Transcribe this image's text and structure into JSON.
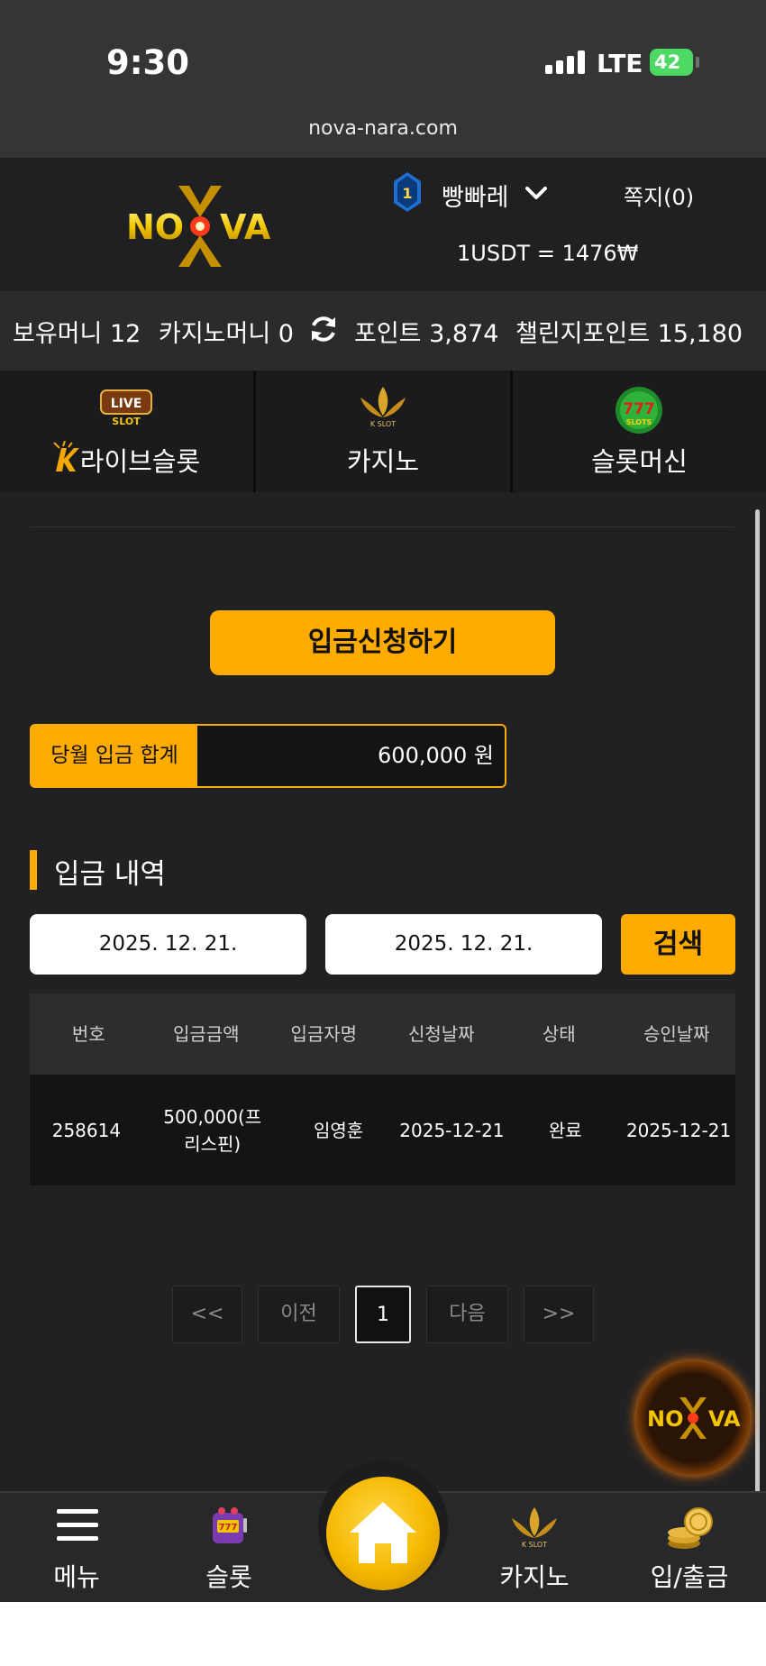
{
  "status_bar": {
    "time": "9:30",
    "network": "LTE",
    "battery": "42",
    "url": "nova-nara.com"
  },
  "header": {
    "logo_text": "NOVA",
    "rank": "1",
    "username": "빵빠레",
    "messages": "쪽지(0)",
    "exchange_rate": "1USDT = 1476₩"
  },
  "balance": {
    "money": "보유머니 12",
    "casino_money": "카지노머니 0",
    "points": "포인트 3,874",
    "challenge_points": "챌린지포인트 15,180"
  },
  "categories": [
    {
      "label": "라이브슬롯",
      "icon": "live-slot-icon"
    },
    {
      "label": "카지노",
      "icon": "k-slot-lotus-icon"
    },
    {
      "label": "슬롯머신",
      "icon": "777-slots-icon"
    }
  ],
  "main": {
    "apply_button": "입금신청하기",
    "monthly_total_label": "당월 입금 합계",
    "monthly_total_value": "600,000 원",
    "section_title": "입금 내역",
    "date_from": "2025. 12. 21.",
    "date_to": "2025. 12. 21.",
    "search_button": "검색"
  },
  "table": {
    "headers": [
      "번호",
      "입금금액",
      "입금자명",
      "신청날짜",
      "상태",
      "승인날짜"
    ],
    "rows": [
      [
        "258614",
        "500,000(프리스핀)",
        "임영훈",
        "2025-12-21",
        "완료",
        "2025-12-21"
      ]
    ]
  },
  "pagination": {
    "first": "<<",
    "prev": "이전",
    "current": "1",
    "next": "다음",
    "last": ">>"
  },
  "bottom_nav": [
    {
      "label": "메뉴",
      "icon": "hamburger-icon"
    },
    {
      "label": "슬롯",
      "icon": "slot-machine-icon"
    },
    {
      "label": "",
      "icon": "home-icon"
    },
    {
      "label": "카지노",
      "icon": "k-slot-lotus-icon"
    },
    {
      "label": "입/출금",
      "icon": "coins-icon"
    }
  ],
  "colors": {
    "accent": "#ffab00",
    "background": "#212123",
    "header": "#202022"
  }
}
